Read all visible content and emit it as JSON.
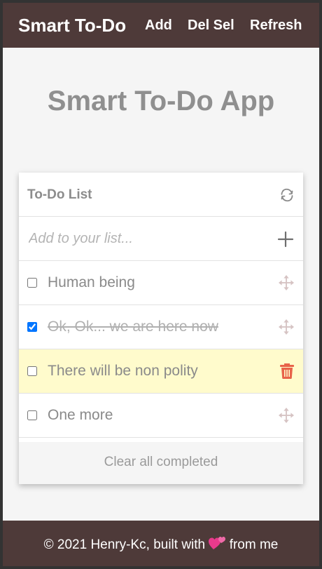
{
  "navbar": {
    "brand": "Smart To-Do",
    "links": [
      "Add",
      "Del Sel",
      "Refresh"
    ]
  },
  "page": {
    "title": "Smart To-Do App"
  },
  "card": {
    "title": "To-Do List",
    "input_placeholder": "Add to your list...",
    "items": [
      {
        "text": "Human being",
        "checked": false,
        "highlighted": false,
        "action_icon": "move-icon"
      },
      {
        "text": "Ok, Ok... we are here now",
        "checked": true,
        "highlighted": false,
        "action_icon": "move-icon"
      },
      {
        "text": "There will be non polity",
        "checked": false,
        "highlighted": true,
        "action_icon": "trash-icon"
      },
      {
        "text": "One more",
        "checked": false,
        "highlighted": false,
        "action_icon": "move-icon"
      }
    ],
    "clear_label": "Clear all completed"
  },
  "footer": {
    "prefix": "© 2021 Henry-Kc, built with",
    "suffix": "from me",
    "icon": "hearts-icon"
  },
  "colors": {
    "navbar_bg": "#4e3a39",
    "page_bg": "#f5f5f5",
    "highlight_bg": "#fffbcc",
    "trash": "#e8634a",
    "heart": "#e93a8c"
  }
}
